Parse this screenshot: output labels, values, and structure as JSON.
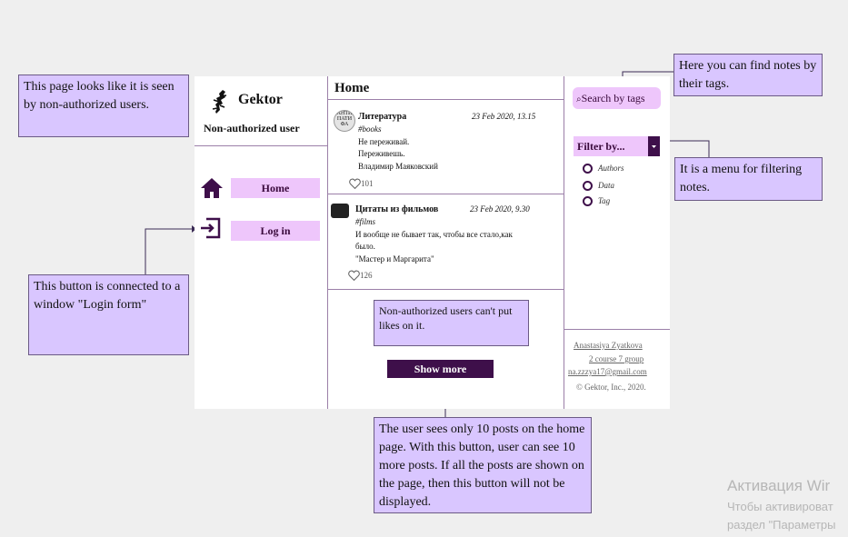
{
  "brand": "Gektor",
  "user_status": "Non-authorized user",
  "nav": {
    "home": "Home",
    "login": "Log in"
  },
  "page_title": "Home",
  "posts": [
    {
      "title": "Литература",
      "date": "23 Feb 2020, 13.15",
      "tag": "#books",
      "lines": [
        "Не переживай.",
        "Переживешь.",
        "Владимир Маяковский"
      ],
      "likes": "101",
      "avatar_text": "АНТИ ПАТИ ФА"
    },
    {
      "title": "Цитаты из фильмов",
      "date": "23 Feb 2020, 9.30",
      "tag": "#films",
      "lines": [
        "И вообще не бывает так, чтобы все стало,как",
        "было.",
        "\"Мастер и Маргарита\""
      ],
      "likes": "126"
    }
  ],
  "show_more": "Show more",
  "search": {
    "label": "Search by tags",
    "icon": "search-icon"
  },
  "filter": {
    "label": "Filter by...",
    "options": [
      "Authors",
      "Data",
      "Tag"
    ]
  },
  "footer": {
    "author": "Anastasiya Zyatkova",
    "group": "2 course 7 group",
    "email": "na.zzzya17@gmail.com",
    "copyright": "© Gektor, Inc., 2020."
  },
  "notes": {
    "non_auth": "This page looks like it is seen by non-authorized users.",
    "tags": "Here you can find notes by their tags.",
    "filter": "It is a menu for filtering notes.",
    "login": "This button  is connected to a window \"Login form\"",
    "likes": "Non-authorized users can't put likes on it.",
    "show_more": "The user sees only 10 posts on the home page. With this button, user can see 10 more posts. If all the posts are shown on the page, then this button will not be displayed."
  },
  "watermark": {
    "title": "Активация Wir",
    "line1": "Чтобы активироват",
    "line2": "раздел \"Параметры"
  },
  "colors": {
    "accent": "#eec6fb",
    "dark": "#3e0f4a",
    "note_bg": "#d9c6ff",
    "border": "#9b7fa8"
  }
}
